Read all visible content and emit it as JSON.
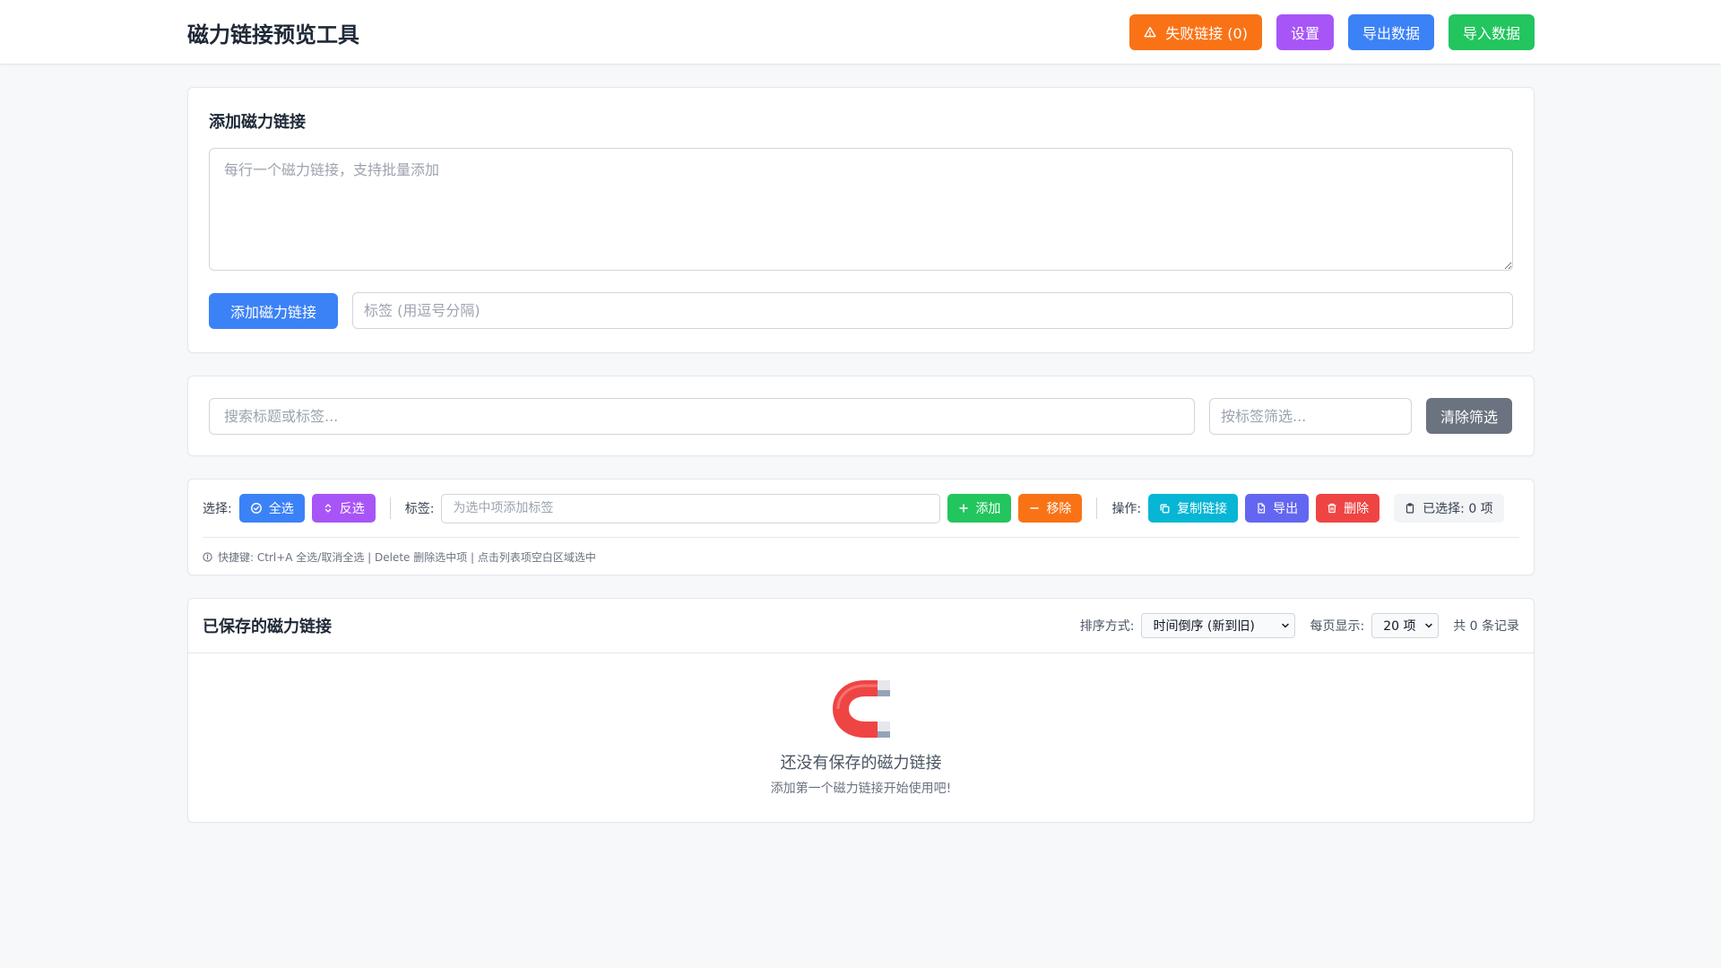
{
  "header": {
    "title": "磁力链接预览工具",
    "failed_links_label": "失败链接 (0)",
    "settings_label": "设置",
    "export_label": "导出数据",
    "import_label": "导入数据"
  },
  "add_section": {
    "title": "添加磁力链接",
    "textarea_placeholder": "每行一个磁力链接，支持批量添加",
    "add_button": "添加磁力链接",
    "tags_placeholder": "标签 (用逗号分隔)"
  },
  "filter_section": {
    "search_placeholder": "搜索标题或标签...",
    "tag_filter_placeholder": "按标签筛选...",
    "clear_button": "清除筛选"
  },
  "bulk_section": {
    "select_label": "选择:",
    "select_all": "全选",
    "invert": "反选",
    "tags_label": "标签:",
    "tag_input_placeholder": "为选中项添加标签",
    "add_tag": "添加",
    "remove_tag": "移除",
    "ops_label": "操作:",
    "copy_links": "复制链接",
    "export": "导出",
    "delete": "删除",
    "selected_count": "已选择: 0 项",
    "shortcut_hint": "快捷键: Ctrl+A 全选/取消全选 | Delete 删除选中项 | 点击列表项空白区域选中"
  },
  "list_section": {
    "title": "已保存的磁力链接",
    "sort_label": "排序方式:",
    "sort_value": "时间倒序 (新到旧)",
    "per_page_label": "每页显示:",
    "per_page_value": "20 项",
    "total": "共 0 条记录",
    "empty_title": "还没有保存的磁力链接",
    "empty_subtitle": "添加第一个磁力链接开始使用吧!"
  },
  "icons": {
    "failed": "warning-icon",
    "select_all": "check-circle-icon",
    "invert": "chevron-updown-icon",
    "add_tag": "plus-icon",
    "remove_tag": "minus-icon",
    "copy": "copy-icon",
    "export": "file-icon",
    "delete": "trash-icon",
    "clipboard": "clipboard-icon",
    "info": "info-icon",
    "empty": "magnet-icon"
  },
  "colors": {
    "primary": "#3b82f6",
    "orange": "#f97316",
    "purple": "#a855f7",
    "green": "#22c55e",
    "cyan": "#06b6d4",
    "indigo": "#6366f1",
    "red": "#ef4444",
    "gray": "#6b7280"
  }
}
